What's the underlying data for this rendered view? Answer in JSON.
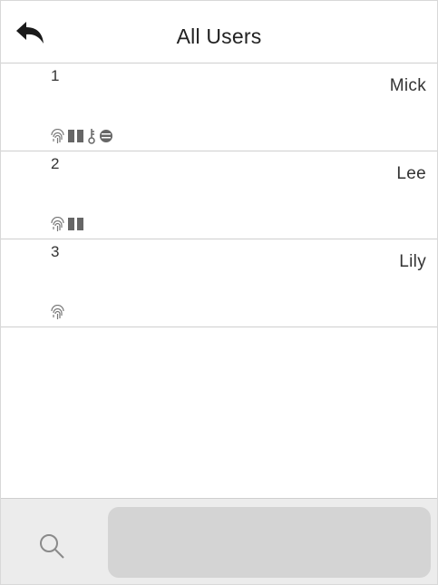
{
  "header": {
    "title": "All Users",
    "back_icon": "back-arrow-icon"
  },
  "users": [
    {
      "id": "1",
      "name": "Mick",
      "icons": [
        "fingerprint-icon",
        "card-icon",
        "password-key-icon",
        "face-icon"
      ]
    },
    {
      "id": "2",
      "name": "Lee",
      "icons": [
        "fingerprint-icon",
        "card-icon"
      ]
    },
    {
      "id": "3",
      "name": "Lily",
      "icons": [
        "fingerprint-icon"
      ]
    }
  ],
  "footer": {
    "search_icon": "search-icon",
    "search_value": ""
  },
  "colors": {
    "divider": "#cfcfcf",
    "footer_bg": "#ececec",
    "search_field_bg": "#d4d4d4",
    "icon_gray": "#6f6f6f"
  }
}
